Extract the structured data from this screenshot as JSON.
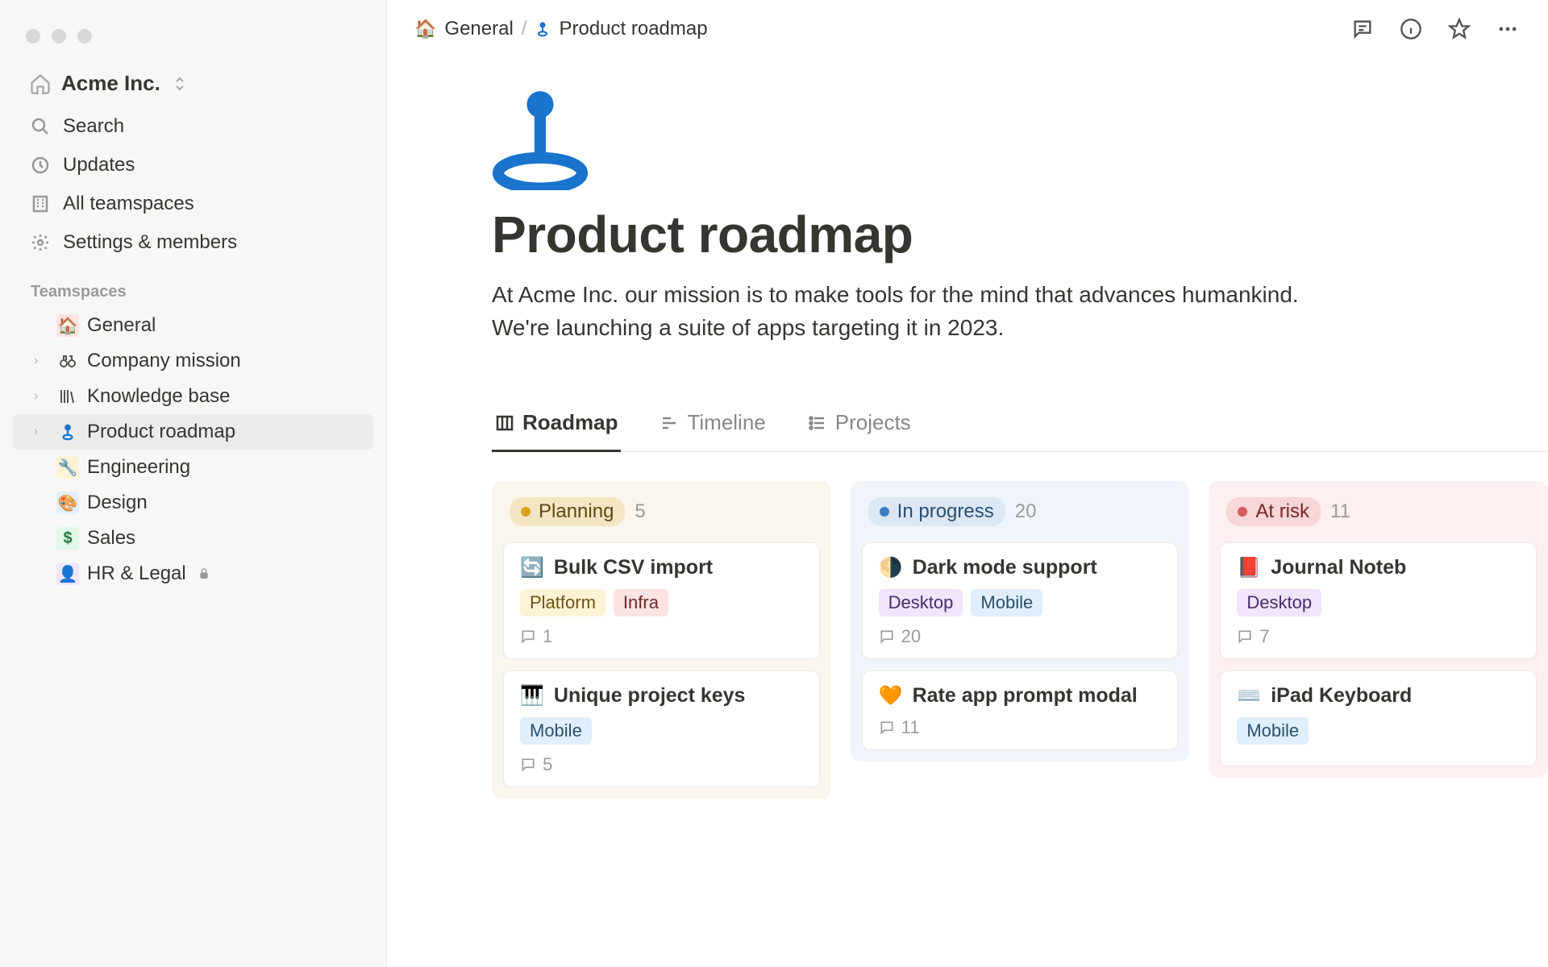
{
  "workspace": {
    "name": "Acme Inc."
  },
  "sidebar": {
    "nav": {
      "search": "Search",
      "updates": "Updates",
      "teamspaces": "All teamspaces",
      "settings": "Settings & members"
    },
    "section_label": "Teamspaces",
    "items": [
      {
        "label": "General",
        "icon": "🏠"
      },
      {
        "label": "Company mission"
      },
      {
        "label": "Knowledge base"
      },
      {
        "label": "Product roadmap"
      },
      {
        "label": "Engineering",
        "icon": "🔧"
      },
      {
        "label": "Design",
        "icon": "🎨"
      },
      {
        "label": "Sales",
        "icon": "$"
      },
      {
        "label": "HR & Legal",
        "icon": "👤"
      }
    ]
  },
  "breadcrumb": {
    "root": "General",
    "page": "Product roadmap"
  },
  "page": {
    "title": "Product roadmap",
    "description": "At Acme Inc. our mission is to make tools for the mind that advances humankind. We're launching a suite of apps targeting it in 2023."
  },
  "views": [
    {
      "label": "Roadmap"
    },
    {
      "label": "Timeline"
    },
    {
      "label": "Projects"
    }
  ],
  "board": {
    "columns": [
      {
        "status": "Planning",
        "count": "5",
        "cards": [
          {
            "emoji": "🔄",
            "title": "Bulk CSV import",
            "tags": [
              "Platform",
              "Infra"
            ],
            "comments": "1"
          },
          {
            "emoji": "🎹",
            "title": "Unique project keys",
            "tags": [
              "Mobile"
            ],
            "comments": "5"
          }
        ]
      },
      {
        "status": "In progress",
        "count": "20",
        "cards": [
          {
            "emoji": "🌗",
            "title": "Dark mode support",
            "tags": [
              "Desktop",
              "Mobile"
            ],
            "comments": "20"
          },
          {
            "emoji": "🧡",
            "title": "Rate app prompt modal",
            "tags": [],
            "comments": "11"
          }
        ]
      },
      {
        "status": "At risk",
        "count": "11",
        "cards": [
          {
            "emoji": "📕",
            "title": "Journal Noteb",
            "tags": [
              "Desktop"
            ],
            "comments": "7"
          },
          {
            "emoji": "⌨️",
            "title": "iPad Keyboard",
            "tags": [
              "Mobile"
            ],
            "comments": ""
          }
        ]
      }
    ]
  },
  "tag_styles": {
    "Platform": "tag-platform",
    "Infra": "tag-infra",
    "Desktop": "tag-desktop",
    "Mobile": "tag-mobile"
  }
}
